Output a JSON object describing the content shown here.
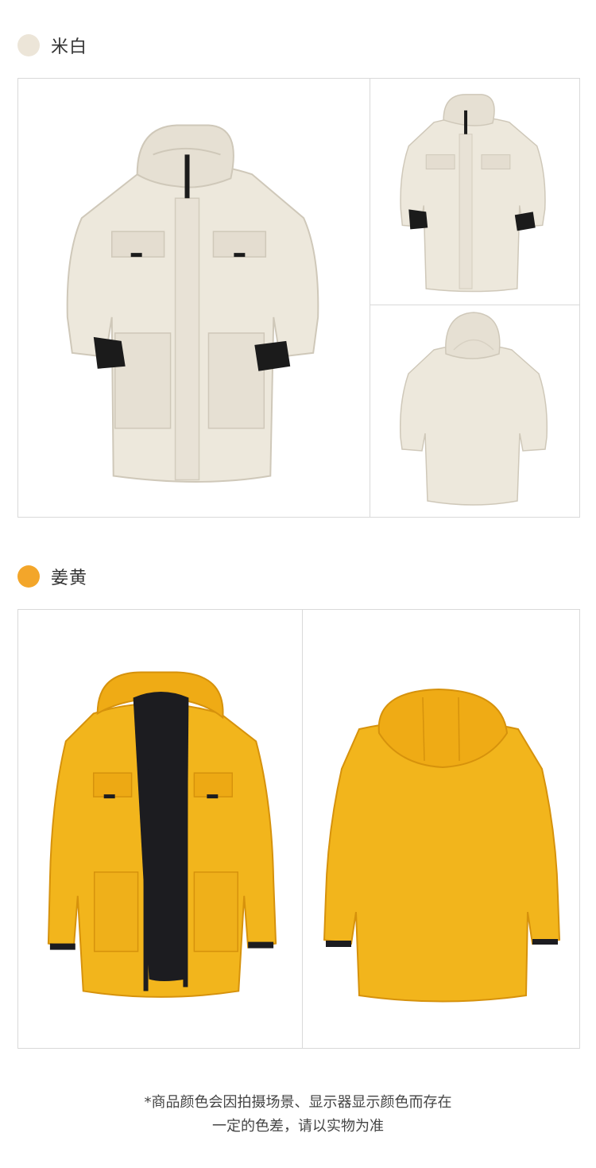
{
  "colors": [
    {
      "name": "米白",
      "swatch": "#ece5d8",
      "jacket": "#ede8dc",
      "shade": "#d8d1c3",
      "trim": "#1b1b1b"
    },
    {
      "name": "姜黄",
      "swatch": "#f3a62a",
      "jacket": "#f2b51c",
      "shade": "#d6920c",
      "trim": "#1c1c20"
    }
  ],
  "views": {
    "beige": [
      "front-large",
      "front-small",
      "back-small"
    ],
    "yellow": [
      "front-open",
      "back"
    ]
  },
  "footnote": {
    "line1": "*商品颜色会因拍摄场景、显示器显示颜色而存在",
    "line2": "一定的色差，请以实物为准"
  }
}
